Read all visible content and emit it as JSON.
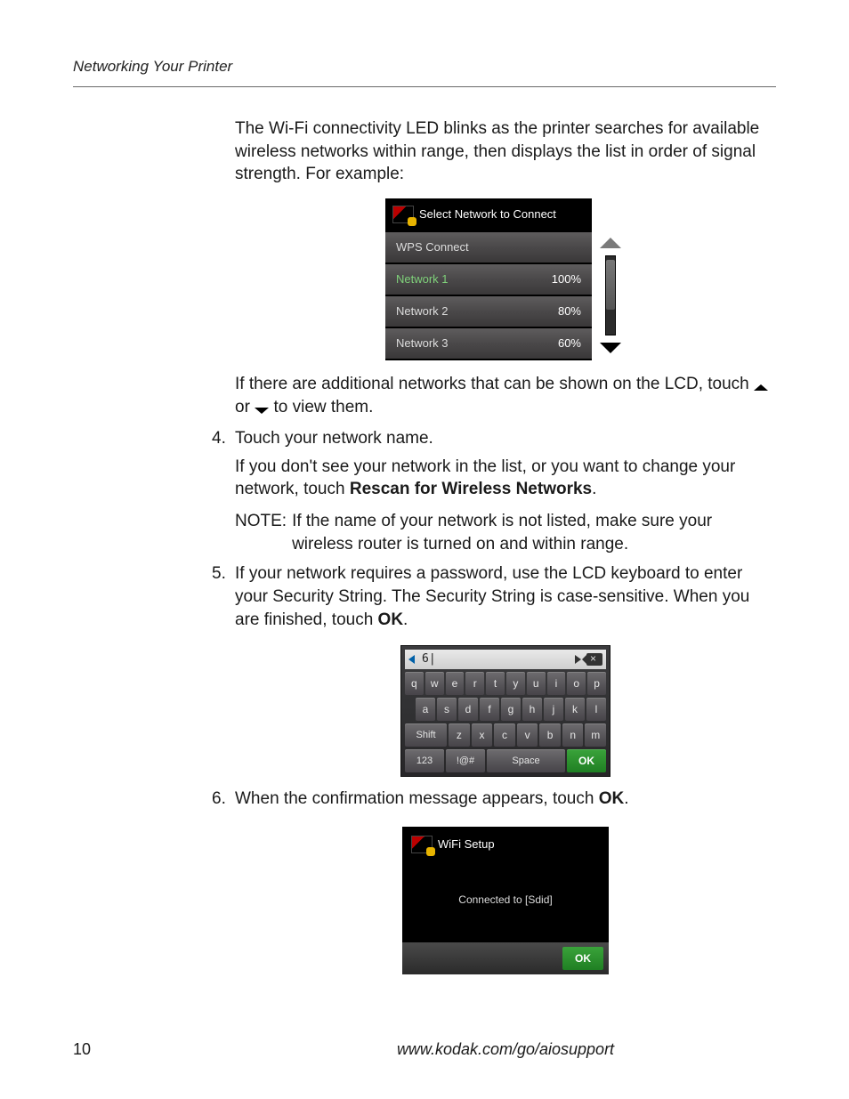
{
  "header": {
    "section_title": "Networking Your Printer"
  },
  "footer": {
    "page_number": "10",
    "url": "www.kodak.com/go/aiosupport"
  },
  "p_intro": "The Wi-Fi connectivity LED blinks as the printer searches for available wireless networks within range, then displays the list in order of signal strength. For example:",
  "fig_net": {
    "title": "Select Network to Connect",
    "rows": [
      {
        "label": "WPS Connect",
        "pct": ""
      },
      {
        "label": "Network 1",
        "pct": "100%"
      },
      {
        "label": "Network 2",
        "pct": "80%"
      },
      {
        "label": "Network 3",
        "pct": "60%"
      }
    ]
  },
  "p_after_net_a": "If there are additional networks that can be shown on the LCD, touch ",
  "p_after_net_b": " or ",
  "p_after_net_c": " to view them.",
  "step4": {
    "num": "4.",
    "text": "Touch your network name.",
    "sub1_a": "If you don't see your network in the list, or you want to change your network, touch ",
    "sub1_bold": "Rescan for Wireless Networks",
    "sub1_b": ".",
    "note_label": "NOTE:",
    "note_body": "If the name of your network is not listed, make sure your wireless router is turned on and within range."
  },
  "step5": {
    "num": "5.",
    "text_a": "If your network requires a password, use the LCD keyboard to enter your Security String. The Security String is case-sensitive. When you are finished, touch ",
    "text_bold": "OK",
    "text_b": "."
  },
  "fig_kbd": {
    "entry": "6|",
    "row1": [
      "q",
      "w",
      "e",
      "r",
      "t",
      "y",
      "u",
      "i",
      "o",
      "p"
    ],
    "row2": [
      "a",
      "s",
      "d",
      "f",
      "g",
      "h",
      "j",
      "k",
      "l"
    ],
    "row3_shift": "Shift",
    "row3": [
      "z",
      "x",
      "c",
      "v",
      "b",
      "n",
      "m"
    ],
    "row4": {
      "k123": "123",
      "sym": "!@#",
      "space": "Space",
      "ok": "OK"
    }
  },
  "step6": {
    "num": "6.",
    "text_a": "When the confirmation message appears, touch ",
    "text_bold": "OK",
    "text_b": "."
  },
  "fig_ok": {
    "title": "WiFi Setup",
    "body": "Connected to [Sdid]",
    "ok": "OK"
  }
}
